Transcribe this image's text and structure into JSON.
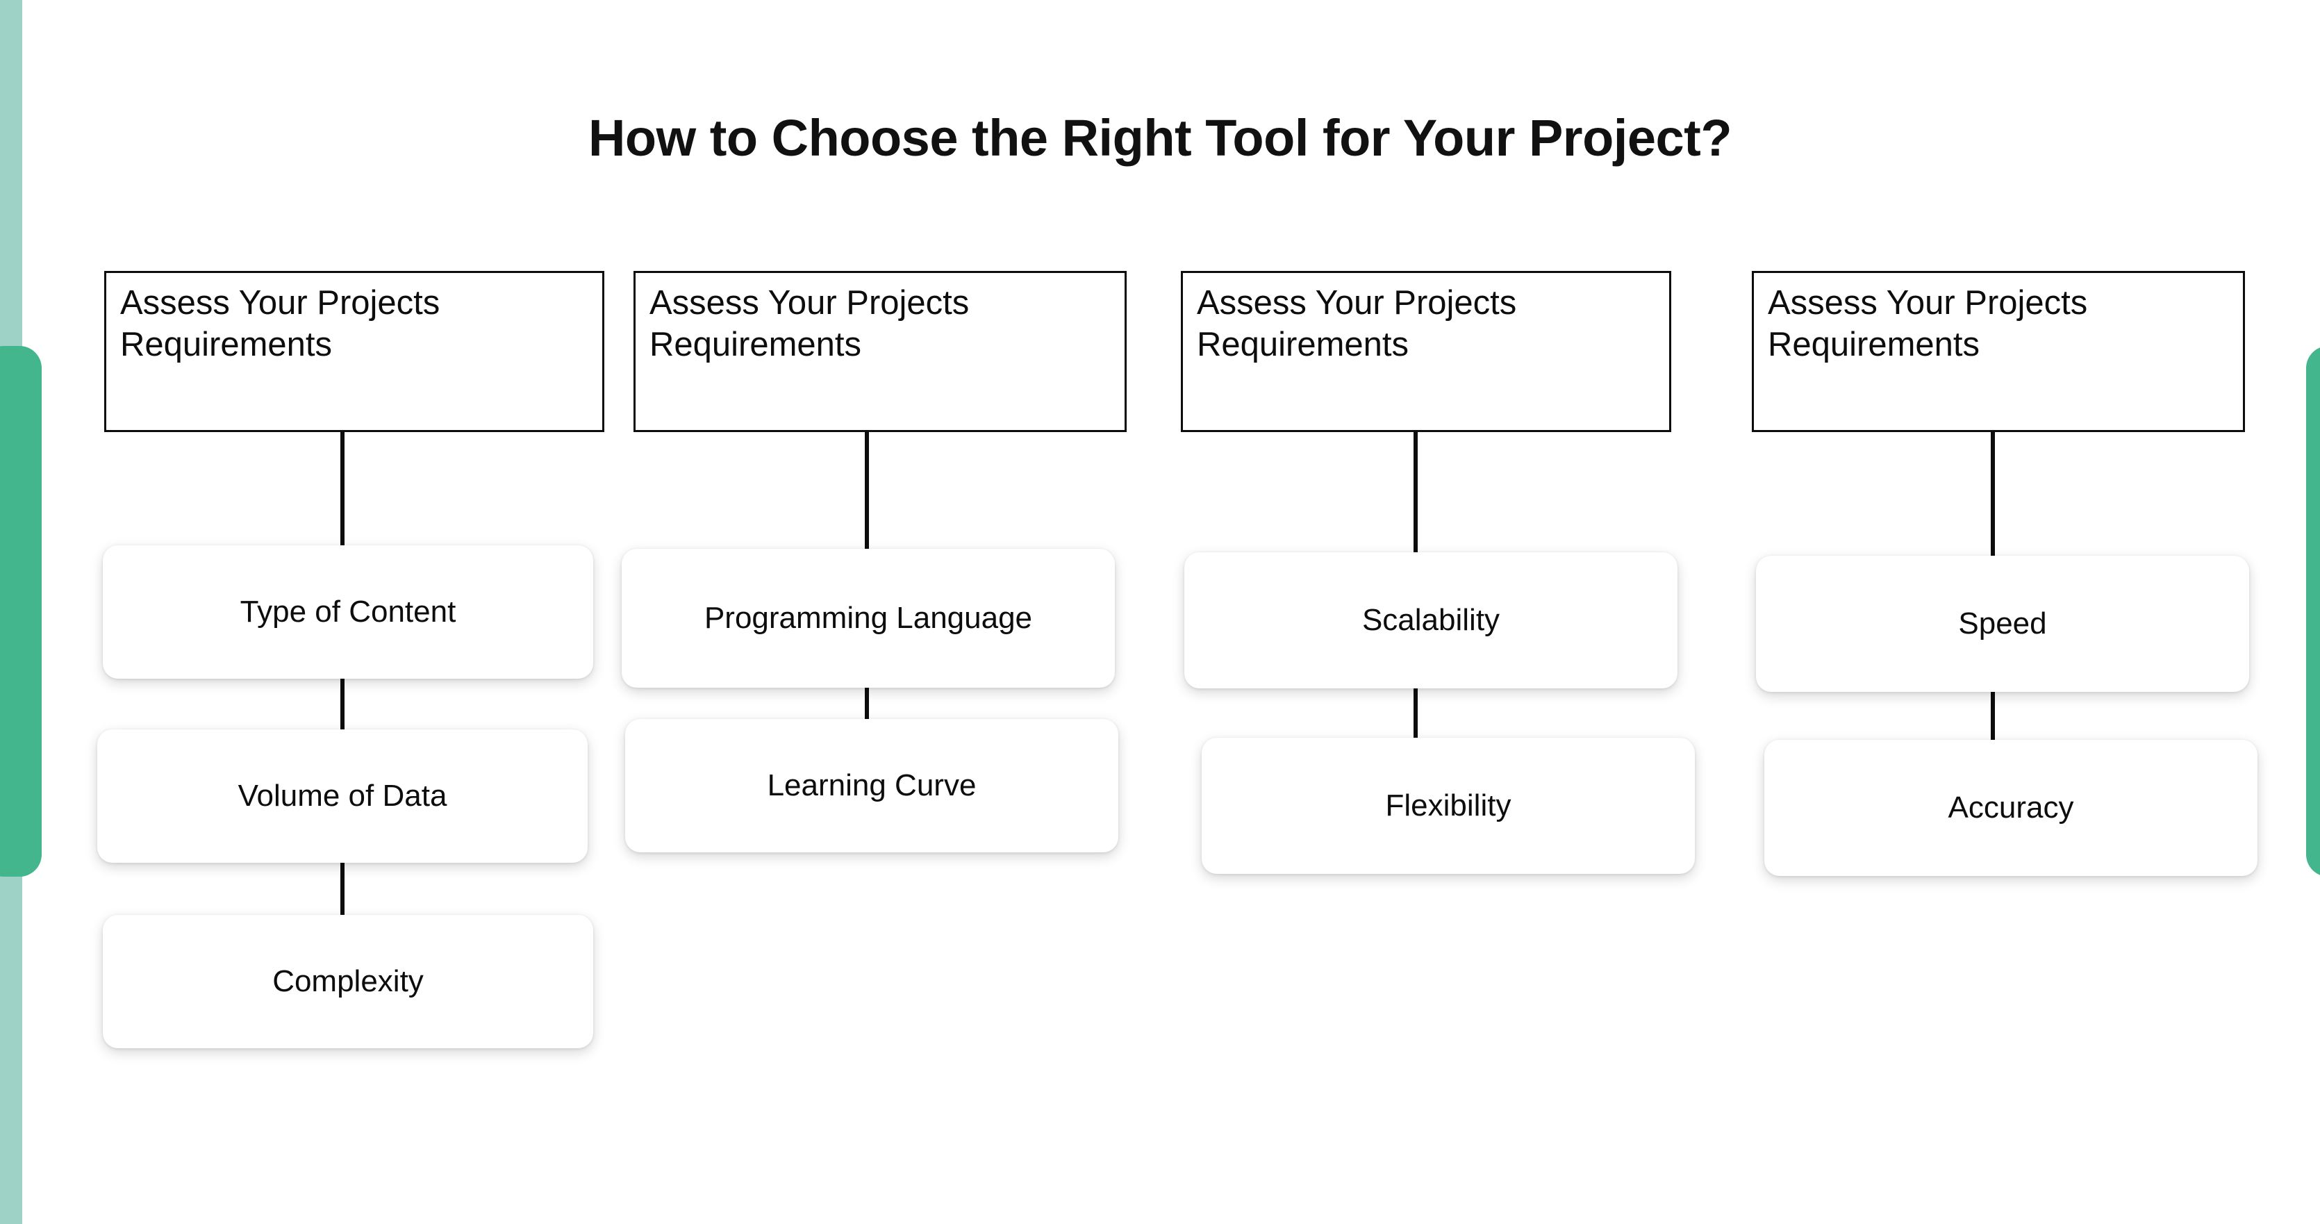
{
  "page": {
    "title": "How to Choose the Right Tool for Your Project?",
    "background_color": "#ffffff",
    "accent_color_dark": "#43b68e",
    "accent_color_light": "#9fd2c7",
    "text_color": "#0d0d0d"
  },
  "chart_data": {
    "type": "diagram",
    "diagram_kind": "tree-flowchart",
    "title": "How to Choose the Right Tool for Your Project?",
    "columns": [
      {
        "header": "Assess Your Projects Requirements",
        "nodes": [
          "Type of Content",
          "Volume of Data",
          "Complexity"
        ]
      },
      {
        "header": "Assess Your Projects Requirements",
        "nodes": [
          "Programming Language",
          "Learning Curve"
        ]
      },
      {
        "header": "Assess Your Projects Requirements",
        "nodes": [
          "Scalability",
          "Flexibility"
        ]
      },
      {
        "header": "Assess Your Projects Requirements",
        "nodes": [
          "Speed",
          "Accuracy"
        ]
      }
    ]
  },
  "columns": [
    {
      "header": "Assess Your Projects Requirements",
      "node_1": "Type of Content",
      "node_2": "Volume of Data",
      "node_3": "Complexity"
    },
    {
      "header": "Assess Your Projects Requirements",
      "node_1": "Programming Language",
      "node_2": "Learning Curve"
    },
    {
      "header": "Assess Your Projects Requirements",
      "node_1": "Scalability",
      "node_2": "Flexibility"
    },
    {
      "header": "Assess Your Projects Requirements",
      "node_1": "Speed",
      "node_2": "Accuracy"
    }
  ]
}
